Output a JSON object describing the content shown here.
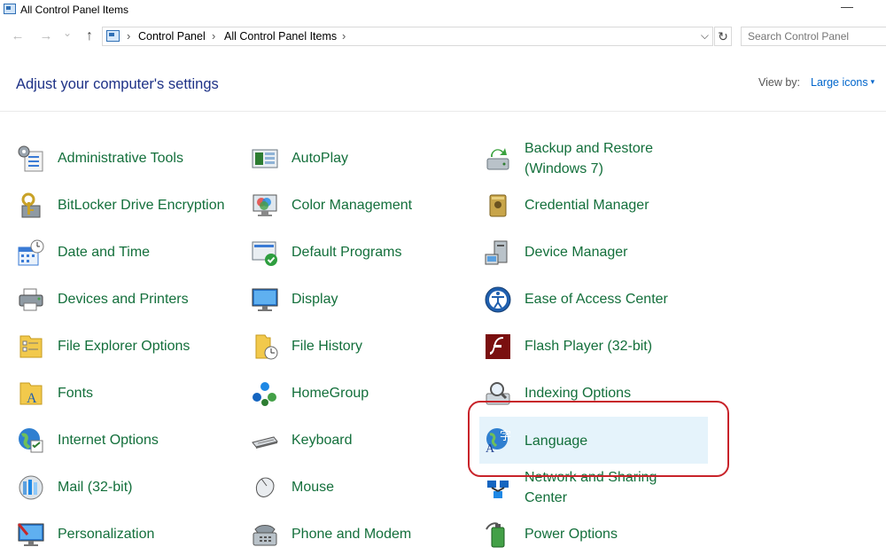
{
  "window": {
    "title": "All Control Panel Items",
    "minimize_glyph": "—"
  },
  "nav": {
    "back_glyph": "←",
    "forward_glyph": "→",
    "dropdown_glyph": "⌄",
    "up_glyph": "↑",
    "breadcrumbs": [
      "Control Panel",
      "All Control Panel Items"
    ],
    "separator": "›",
    "address_dropdown_glyph": "⌵",
    "refresh_glyph": "↻",
    "search_placeholder": "Search Control Panel"
  },
  "header": {
    "title": "Adjust your computer's settings",
    "view_by_label": "View by:",
    "view_by_value": "Large icons",
    "view_by_caret": "▾"
  },
  "items": [
    {
      "label": "Administrative Tools",
      "icon": "admin-tools-icon"
    },
    {
      "label": "AutoPlay",
      "icon": "autoplay-icon"
    },
    {
      "label": "Backup and Restore\n(Windows 7)",
      "icon": "backup-restore-icon"
    },
    {
      "label": "BitLocker Drive Encryption",
      "icon": "bitlocker-icon"
    },
    {
      "label": "Color Management",
      "icon": "color-management-icon"
    },
    {
      "label": "Credential Manager",
      "icon": "credential-manager-icon"
    },
    {
      "label": "Date and Time",
      "icon": "date-time-icon"
    },
    {
      "label": "Default Programs",
      "icon": "default-programs-icon"
    },
    {
      "label": "Device Manager",
      "icon": "device-manager-icon"
    },
    {
      "label": "Devices and Printers",
      "icon": "devices-printers-icon"
    },
    {
      "label": "Display",
      "icon": "display-icon"
    },
    {
      "label": "Ease of Access Center",
      "icon": "ease-of-access-icon"
    },
    {
      "label": "File Explorer Options",
      "icon": "file-explorer-options-icon"
    },
    {
      "label": "File History",
      "icon": "file-history-icon"
    },
    {
      "label": "Flash Player (32-bit)",
      "icon": "flash-player-icon"
    },
    {
      "label": "Fonts",
      "icon": "fonts-icon"
    },
    {
      "label": "HomeGroup",
      "icon": "homegroup-icon"
    },
    {
      "label": "Indexing Options",
      "icon": "indexing-options-icon"
    },
    {
      "label": "Internet Options",
      "icon": "internet-options-icon"
    },
    {
      "label": "Keyboard",
      "icon": "keyboard-icon"
    },
    {
      "label": "Language",
      "icon": "language-icon",
      "selected": true
    },
    {
      "label": "Mail (32-bit)",
      "icon": "mail-icon"
    },
    {
      "label": "Mouse",
      "icon": "mouse-icon"
    },
    {
      "label": "Network and Sharing\nCenter",
      "icon": "network-sharing-icon"
    },
    {
      "label": "Personalization",
      "icon": "personalization-icon"
    },
    {
      "label": "Phone and Modem",
      "icon": "phone-modem-icon"
    },
    {
      "label": "Power Options",
      "icon": "power-options-icon"
    }
  ],
  "colors": {
    "link_green": "#136f3b",
    "heading_blue": "#1e3287",
    "highlight_red": "#c8232a",
    "selected_bg": "#e5f3fb"
  }
}
